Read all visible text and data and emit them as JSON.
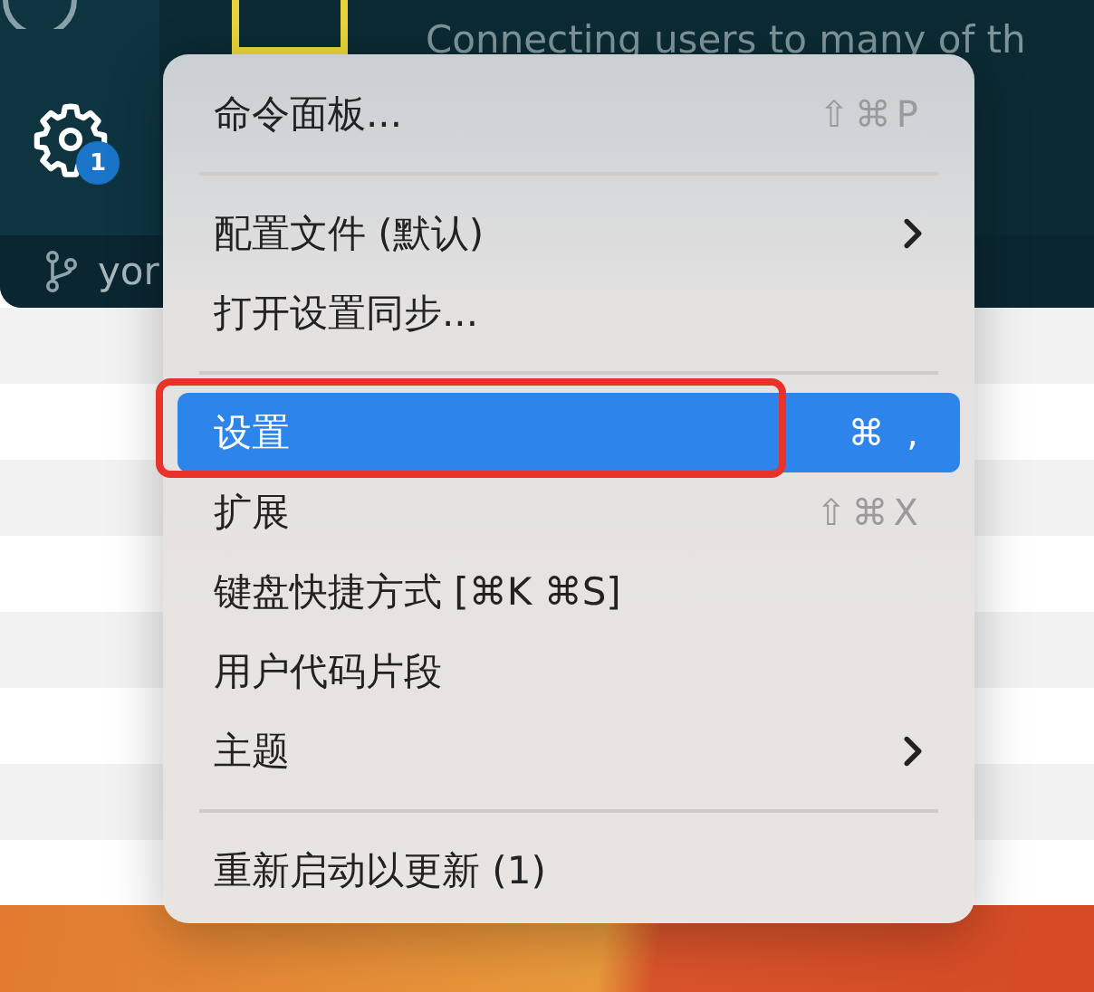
{
  "background": {
    "description": "Connecting users to many of th",
    "notification_badge": "1",
    "branch_label": "yor"
  },
  "menu": {
    "items": [
      {
        "kind": "item",
        "label": "命令面板...",
        "shortcut": "⇧⌘P",
        "submenu": false,
        "selected": false,
        "outlined": false
      },
      {
        "kind": "separator"
      },
      {
        "kind": "item",
        "label": "配置文件 (默认)",
        "submenu": true,
        "selected": false,
        "outlined": false
      },
      {
        "kind": "item",
        "label": "打开设置同步...",
        "submenu": false,
        "selected": false,
        "outlined": false
      },
      {
        "kind": "separator"
      },
      {
        "kind": "item",
        "label": "设置",
        "shortcut": "⌘ ,",
        "submenu": false,
        "selected": true,
        "outlined": true
      },
      {
        "kind": "item",
        "label": "扩展",
        "shortcut": "⇧⌘X",
        "submenu": false,
        "selected": false,
        "outlined": false
      },
      {
        "kind": "item",
        "label": "键盘快捷方式 [⌘K ⌘S]",
        "submenu": false,
        "selected": false,
        "outlined": false
      },
      {
        "kind": "item",
        "label": "用户代码片段",
        "submenu": false,
        "selected": false,
        "outlined": false
      },
      {
        "kind": "item",
        "label": "主题",
        "submenu": true,
        "selected": false,
        "outlined": false
      },
      {
        "kind": "separator"
      },
      {
        "kind": "item",
        "label": "重新启动以更新 (1)",
        "submenu": false,
        "selected": false,
        "outlined": false
      }
    ]
  }
}
